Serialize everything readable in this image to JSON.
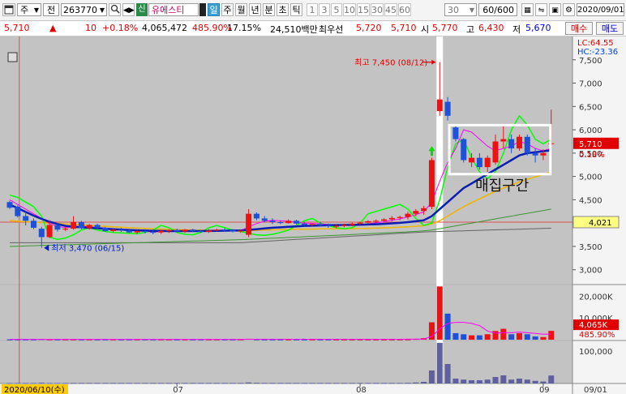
{
  "toolbar": {
    "chart_type_icon": "chart-window-icon",
    "period_unit": "주",
    "market_scope": "전",
    "code": "263770",
    "search_icon": "search-icon",
    "credit_badge": "신",
    "stock_name": "유에스티",
    "period_tabs": [
      "일",
      "주",
      "월",
      "년",
      "분",
      "초",
      "틱"
    ],
    "selected_tab": "일",
    "minute_options": [
      "1",
      "3",
      "5",
      "10",
      "15",
      "30",
      "45",
      "60"
    ],
    "count_box": "30",
    "range_display": "60/600",
    "date": "2020/09/01"
  },
  "quote": {
    "price": "5,710",
    "change_arrow": "▲",
    "change": "10",
    "change_rate": "+0.18%",
    "volume": "4,065,472",
    "volume_ratio": "485.90%",
    "turnover": "17.15%",
    "amount": "24,510백만",
    "best_ask_label": "최우선",
    "best_ask": "5,720",
    "best_bid": "5,710",
    "open_label": "시",
    "open": "5,770",
    "high_label": "고",
    "high": "6,430",
    "low_label": "저",
    "low": "5,670",
    "buy_label": "매수",
    "sell_label": "매도"
  },
  "colors": {
    "rise": "#ee1111",
    "fall": "#1e50d8",
    "ma5": "#ff00ff",
    "ma20": "#0a1eb4",
    "ma60": "#f0b400",
    "ma120": "#3c9632",
    "ma240": "#646464",
    "envelope": "#00ff00",
    "volume_bar": "#6060a0"
  },
  "chart_data": [
    {
      "type": "candlestick",
      "title": "",
      "price_axis_ticks": [
        3000,
        3500,
        4000,
        4500,
        5000,
        5500,
        6000,
        6500,
        7000,
        7500
      ],
      "ylim": [
        2700,
        8000
      ],
      "lc_label": "LC:64.55",
      "hc_label": "HC:-23.36",
      "current_price_label": "5,710",
      "current_rate_label": "0.18%",
      "crosshair_price_label": "4,021",
      "high_annotation": "최고 7,450 (08/12)",
      "low_annotation": "최저 3,470 (06/15)",
      "box_annotation": "매집구간",
      "candles": [
        {
          "o": 4450,
          "h": 4480,
          "l": 4300,
          "c": 4330
        },
        {
          "o": 4350,
          "h": 4380,
          "l": 4120,
          "c": 4150
        },
        {
          "o": 4150,
          "h": 4250,
          "l": 3950,
          "c": 4050
        },
        {
          "o": 4050,
          "h": 4100,
          "l": 3870,
          "c": 3900
        },
        {
          "o": 3880,
          "h": 3920,
          "l": 3470,
          "c": 3700
        },
        {
          "o": 3700,
          "h": 4060,
          "l": 3680,
          "c": 3960
        },
        {
          "o": 3960,
          "h": 3990,
          "l": 3820,
          "c": 3860
        },
        {
          "o": 3860,
          "h": 3920,
          "l": 3830,
          "c": 3880
        },
        {
          "o": 3880,
          "h": 4150,
          "l": 3860,
          "c": 4020
        },
        {
          "o": 4020,
          "h": 4050,
          "l": 3870,
          "c": 3890
        },
        {
          "o": 3890,
          "h": 3980,
          "l": 3860,
          "c": 3960
        },
        {
          "o": 3960,
          "h": 3990,
          "l": 3880,
          "c": 3900
        },
        {
          "o": 3900,
          "h": 3920,
          "l": 3810,
          "c": 3830
        },
        {
          "o": 3830,
          "h": 3880,
          "l": 3800,
          "c": 3860
        },
        {
          "o": 3860,
          "h": 3900,
          "l": 3810,
          "c": 3840
        },
        {
          "o": 3840,
          "h": 3880,
          "l": 3780,
          "c": 3800
        },
        {
          "o": 3800,
          "h": 3850,
          "l": 3760,
          "c": 3830
        },
        {
          "o": 3830,
          "h": 3870,
          "l": 3780,
          "c": 3810
        },
        {
          "o": 3810,
          "h": 3840,
          "l": 3760,
          "c": 3800
        },
        {
          "o": 3800,
          "h": 3850,
          "l": 3770,
          "c": 3830
        },
        {
          "o": 3830,
          "h": 3860,
          "l": 3790,
          "c": 3850
        },
        {
          "o": 3850,
          "h": 3880,
          "l": 3800,
          "c": 3820
        },
        {
          "o": 3820,
          "h": 3870,
          "l": 3790,
          "c": 3860
        },
        {
          "o": 3860,
          "h": 3880,
          "l": 3810,
          "c": 3830
        },
        {
          "o": 3830,
          "h": 3850,
          "l": 3790,
          "c": 3810
        },
        {
          "o": 3810,
          "h": 3870,
          "l": 3790,
          "c": 3840
        },
        {
          "o": 3840,
          "h": 3880,
          "l": 3820,
          "c": 3860
        },
        {
          "o": 3860,
          "h": 3890,
          "l": 3830,
          "c": 3850
        },
        {
          "o": 3850,
          "h": 3870,
          "l": 3800,
          "c": 3820
        },
        {
          "o": 3820,
          "h": 3860,
          "l": 3790,
          "c": 3840
        },
        {
          "o": 3750,
          "h": 4300,
          "l": 3700,
          "c": 4200
        },
        {
          "o": 4200,
          "h": 4230,
          "l": 4060,
          "c": 4100
        },
        {
          "o": 4100,
          "h": 4150,
          "l": 4020,
          "c": 4050
        },
        {
          "o": 4050,
          "h": 4100,
          "l": 3980,
          "c": 4020
        },
        {
          "o": 4020,
          "h": 4060,
          "l": 3980,
          "c": 4000
        },
        {
          "o": 4000,
          "h": 4080,
          "l": 3990,
          "c": 4050
        },
        {
          "o": 4050,
          "h": 4070,
          "l": 3970,
          "c": 3990
        },
        {
          "o": 3990,
          "h": 4020,
          "l": 3940,
          "c": 3960
        },
        {
          "o": 3960,
          "h": 4000,
          "l": 3930,
          "c": 3980
        },
        {
          "o": 3980,
          "h": 4020,
          "l": 3940,
          "c": 3950
        },
        {
          "o": 3950,
          "h": 3990,
          "l": 3900,
          "c": 3930
        },
        {
          "o": 3930,
          "h": 3970,
          "l": 3890,
          "c": 3940
        },
        {
          "o": 3940,
          "h": 3990,
          "l": 3910,
          "c": 3960
        },
        {
          "o": 3960,
          "h": 4010,
          "l": 3930,
          "c": 3990
        },
        {
          "o": 3990,
          "h": 4030,
          "l": 3960,
          "c": 4010
        },
        {
          "o": 4010,
          "h": 4060,
          "l": 3980,
          "c": 4040
        },
        {
          "o": 4040,
          "h": 4080,
          "l": 4000,
          "c": 4050
        },
        {
          "o": 4050,
          "h": 4100,
          "l": 4010,
          "c": 4080
        },
        {
          "o": 4080,
          "h": 4150,
          "l": 4040,
          "c": 4110
        },
        {
          "o": 4110,
          "h": 4160,
          "l": 4060,
          "c": 4130
        },
        {
          "o": 4130,
          "h": 4240,
          "l": 4080,
          "c": 4200
        },
        {
          "o": 4200,
          "h": 4300,
          "l": 4150,
          "c": 4260
        },
        {
          "o": 4260,
          "h": 4370,
          "l": 4180,
          "c": 4320
        },
        {
          "o": 4350,
          "h": 5400,
          "l": 4300,
          "c": 5350
        },
        {
          "o": 6400,
          "h": 7450,
          "l": 6300,
          "c": 6650
        },
        {
          "o": 6600,
          "h": 6700,
          "l": 6200,
          "c": 6300
        },
        {
          "o": 6050,
          "h": 6100,
          "l": 5750,
          "c": 5800
        },
        {
          "o": 5800,
          "h": 5820,
          "l": 5300,
          "c": 5350
        },
        {
          "o": 5300,
          "h": 5500,
          "l": 5200,
          "c": 5400
        },
        {
          "o": 5400,
          "h": 5500,
          "l": 5150,
          "c": 5200
        },
        {
          "o": 5200,
          "h": 5450,
          "l": 5100,
          "c": 5400
        },
        {
          "o": 5300,
          "h": 5900,
          "l": 5250,
          "c": 5750
        },
        {
          "o": 5750,
          "h": 6100,
          "l": 5600,
          "c": 5800
        },
        {
          "o": 5800,
          "h": 5900,
          "l": 5500,
          "c": 5600
        },
        {
          "o": 5600,
          "h": 5900,
          "l": 5550,
          "c": 5850
        },
        {
          "o": 5850,
          "h": 5900,
          "l": 5450,
          "c": 5500
        },
        {
          "o": 5500,
          "h": 5600,
          "l": 5300,
          "c": 5450
        },
        {
          "o": 5450,
          "h": 5580,
          "l": 5350,
          "c": 5500
        },
        {
          "o": 5700,
          "h": 6430,
          "l": 5670,
          "c": 5710
        }
      ],
      "ma5": [
        4500,
        4400,
        4300,
        4200,
        4100,
        3990,
        3930,
        3900,
        3920,
        3940,
        3920,
        3910,
        3890,
        3870,
        3860,
        3850,
        3830,
        3820,
        3810,
        3815,
        3825,
        3830,
        3835,
        3840,
        3830,
        3830,
        3840,
        3845,
        3840,
        3835,
        3920,
        3990,
        4040,
        4060,
        4050,
        4040,
        4020,
        4000,
        3995,
        3985,
        3970,
        3955,
        3950,
        3955,
        3965,
        3985,
        4005,
        4030,
        4060,
        4090,
        4130,
        4180,
        4240,
        4450,
        4900,
        5300,
        5600,
        6000,
        5950,
        5800,
        5650,
        5550,
        5600,
        5650,
        5750,
        5700,
        5600,
        5550,
        5600
      ],
      "ma20": [
        4400,
        4320,
        4240,
        4160,
        4090,
        4030,
        3980,
        3940,
        3920,
        3910,
        3900,
        3890,
        3880,
        3870,
        3860,
        3850,
        3845,
        3840,
        3835,
        3832,
        3830,
        3830,
        3830,
        3830,
        3830,
        3832,
        3835,
        3838,
        3840,
        3842,
        3855,
        3870,
        3885,
        3900,
        3910,
        3920,
        3930,
        3940,
        3945,
        3950,
        3955,
        3958,
        3960,
        3962,
        3965,
        3970,
        3975,
        3985,
        3995,
        4005,
        4020,
        4040,
        4060,
        4150,
        4300,
        4450,
        4600,
        4750,
        4850,
        4950,
        5050,
        5150,
        5250,
        5350,
        5450,
        5500,
        5520,
        5540,
        5560
      ],
      "ma60": [
        4050,
        4040,
        4030,
        4020,
        4010,
        4000,
        3990,
        3980,
        3970,
        3960,
        3950,
        3940,
        3930,
        3920,
        3910,
        3900,
        3892,
        3885,
        3878,
        3872,
        3866,
        3860,
        3856,
        3852,
        3848,
        3845,
        3842,
        3840,
        3838,
        3836,
        3840,
        3845,
        3850,
        3855,
        3860,
        3865,
        3868,
        3870,
        3872,
        3874,
        3876,
        3878,
        3880,
        3882,
        3885,
        3888,
        3892,
        3898,
        3905,
        3912,
        3920,
        3930,
        3945,
        3980,
        4050,
        4150,
        4250,
        4350,
        4440,
        4520,
        4600,
        4680,
        4750,
        4820,
        4880,
        4940,
        4990,
        5040,
        5100
      ],
      "ma120": [
        3500,
        3505,
        3510,
        3515,
        3520,
        3525,
        3530,
        3535,
        3540,
        3545,
        3550,
        3555,
        3560,
        3565,
        3570,
        3575,
        3580,
        3585,
        3590,
        3595,
        3600,
        3605,
        3610,
        3615,
        3620,
        3625,
        3630,
        3635,
        3640,
        3645,
        3652,
        3660,
        3668,
        3676,
        3684,
        3692,
        3700,
        3708,
        3716,
        3724,
        3732,
        3740,
        3748,
        3756,
        3764,
        3772,
        3780,
        3788,
        3796,
        3804,
        3812,
        3822,
        3834,
        3850,
        3880,
        3910,
        3940,
        3970,
        4000,
        4030,
        4060,
        4090,
        4120,
        4150,
        4180,
        4210,
        4240,
        4270,
        4300
      ],
      "ma240": [
        3580,
        3580,
        3580,
        3580,
        3580,
        3580,
        3580,
        3580,
        3580,
        3580,
        3580,
        3580,
        3580,
        3580,
        3580,
        3580,
        3580,
        3580,
        3580,
        3580,
        3580,
        3580,
        3580,
        3580,
        3580,
        3580,
        3580,
        3580,
        3580,
        3580,
        3590,
        3600,
        3610,
        3620,
        3630,
        3640,
        3650,
        3660,
        3670,
        3680,
        3690,
        3700,
        3710,
        3720,
        3730,
        3740,
        3750,
        3760,
        3770,
        3780,
        3790,
        3800,
        3810,
        3815,
        3820,
        3825,
        3830,
        3835,
        3840,
        3845,
        3850,
        3855,
        3860,
        3865,
        3870,
        3875,
        3880,
        3885,
        3890
      ],
      "envelope": [
        4600,
        4550,
        4450,
        4350,
        4150,
        3700,
        3650,
        3680,
        3750,
        3850,
        3900,
        3850,
        3820,
        3800,
        3790,
        3780,
        3770,
        3800,
        3850,
        3950,
        3900,
        3800,
        3760,
        3750,
        3800,
        3900,
        3950,
        3900,
        3850,
        3820,
        3780,
        3750,
        3740,
        3760,
        3800,
        3850,
        3950,
        4050,
        4100,
        4000,
        3950,
        3900,
        3880,
        3900,
        4000,
        4200,
        4250,
        4300,
        4350,
        4400,
        4300,
        4100,
        3950,
        4000,
        4500,
        5200,
        5700,
        5800,
        5400,
        5100,
        4950,
        5100,
        5500,
        6000,
        6300,
        6100,
        5800,
        5700,
        5800
      ]
    },
    {
      "type": "bar",
      "title": "",
      "series_name": "volume",
      "axis_ticks": [
        "20,000K",
        "10,000K"
      ],
      "ylim": [
        0,
        25000
      ],
      "current_value_label": "4,065K",
      "ratio_label": "485.90%",
      "values": [
        150,
        150,
        150,
        150,
        300,
        150,
        150,
        150,
        150,
        150,
        150,
        150,
        150,
        150,
        150,
        150,
        150,
        150,
        150,
        150,
        150,
        150,
        150,
        150,
        150,
        150,
        150,
        150,
        150,
        150,
        400,
        200,
        150,
        150,
        150,
        150,
        150,
        150,
        150,
        150,
        150,
        150,
        150,
        150,
        150,
        150,
        150,
        150,
        150,
        150,
        200,
        350,
        700,
        8000,
        24500,
        12000,
        3000,
        2500,
        2000,
        2000,
        2500,
        4000,
        5000,
        2500,
        3000,
        2500,
        1500,
        1200,
        4065
      ],
      "ma_line": [
        150,
        150,
        150,
        150,
        150,
        150,
        150,
        150,
        150,
        150,
        150,
        150,
        150,
        150,
        150,
        150,
        150,
        150,
        150,
        150,
        150,
        150,
        150,
        150,
        150,
        150,
        150,
        150,
        150,
        150,
        200,
        200,
        200,
        200,
        200,
        200,
        200,
        200,
        200,
        200,
        200,
        200,
        200,
        200,
        200,
        200,
        200,
        200,
        200,
        200,
        220,
        250,
        300,
        1500,
        5000,
        7500,
        8000,
        8000,
        7500,
        6500,
        4000,
        3000,
        3200,
        3200,
        3500,
        3200,
        2900,
        2500,
        2600
      ]
    },
    {
      "type": "bar",
      "title": "",
      "series_name": "trade-amount",
      "axis_ticks": [
        "100,000"
      ],
      "ylim": [
        0,
        130000
      ],
      "values": [
        1500,
        1500,
        1500,
        1500,
        2500,
        1500,
        1500,
        1500,
        1500,
        1500,
        1500,
        1500,
        1500,
        1500,
        1500,
        1500,
        1500,
        1500,
        1500,
        1500,
        1500,
        1500,
        1500,
        1500,
        1500,
        1500,
        1500,
        1500,
        1500,
        1500,
        3000,
        2000,
        1500,
        1500,
        1500,
        1500,
        1500,
        1500,
        1500,
        1500,
        1500,
        1500,
        1500,
        1500,
        1500,
        1500,
        1500,
        1500,
        1500,
        1500,
        2000,
        3000,
        5000,
        40000,
        125000,
        60000,
        15000,
        12000,
        10000,
        10000,
        12000,
        20000,
        25000,
        12000,
        15000,
        12000,
        8000,
        6000,
        24510
      ]
    }
  ],
  "date_axis": {
    "cursor_date": "2020/06/10(수)",
    "ticks": [
      {
        "label": "07",
        "i": 21
      },
      {
        "label": "08",
        "i": 44
      },
      {
        "label": "09",
        "i": 67
      }
    ],
    "right_date": "09/01"
  }
}
